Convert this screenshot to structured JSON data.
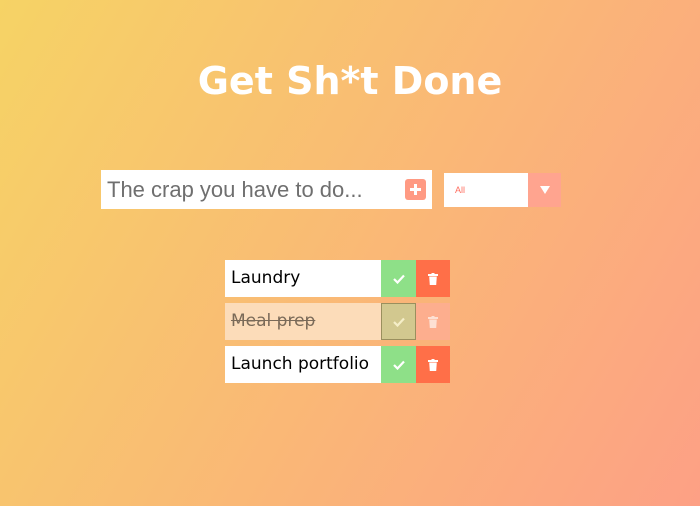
{
  "header": {
    "title": "Get Sh*t Done"
  },
  "form": {
    "placeholder": "The crap you have to do...",
    "add_icon": "plus-square-icon",
    "filter": {
      "selected": "All",
      "arrow_icon": "caret-down-icon"
    }
  },
  "todos": [
    {
      "text": "Laundry",
      "completed": false
    },
    {
      "text": "Meal prep",
      "completed": true
    },
    {
      "text": "Launch portfolio",
      "completed": false
    }
  ],
  "colors": {
    "gradient_start": "#f6d365",
    "gradient_end": "#fda085",
    "complete_green": "#8ee088",
    "trash_orange": "#ff6f48",
    "add_button": "#ff9a83"
  }
}
